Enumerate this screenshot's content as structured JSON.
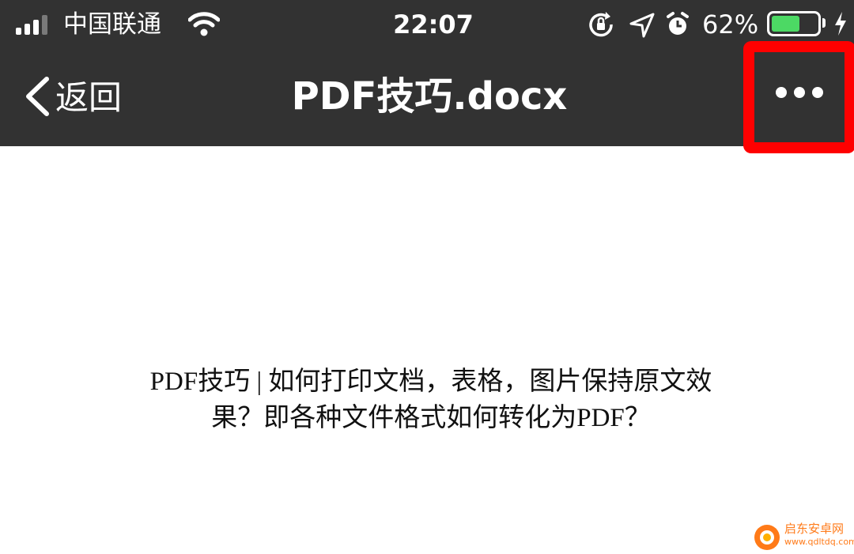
{
  "status_bar": {
    "carrier": "中国联通",
    "time": "22:07",
    "battery_percent": "62%",
    "battery_level": 0.62,
    "battery_color": "#4cd964",
    "icons": [
      "signal-icon",
      "wifi-icon",
      "orientation-lock-icon",
      "location-icon",
      "alarm-icon",
      "battery-icon",
      "charging-icon"
    ]
  },
  "nav": {
    "back_label": "返回",
    "title": "PDF技巧.docx",
    "more_icon": "more-dots-icon",
    "highlight_color": "#ff0000"
  },
  "document": {
    "line1": "PDF技巧 | 如何打印文档，表格，图片保持原文效",
    "line2": "果？即各种文件格式如何转化为PDF？"
  },
  "watermark": {
    "name": "启东安卓网",
    "url": "www.qdltdq.com"
  }
}
